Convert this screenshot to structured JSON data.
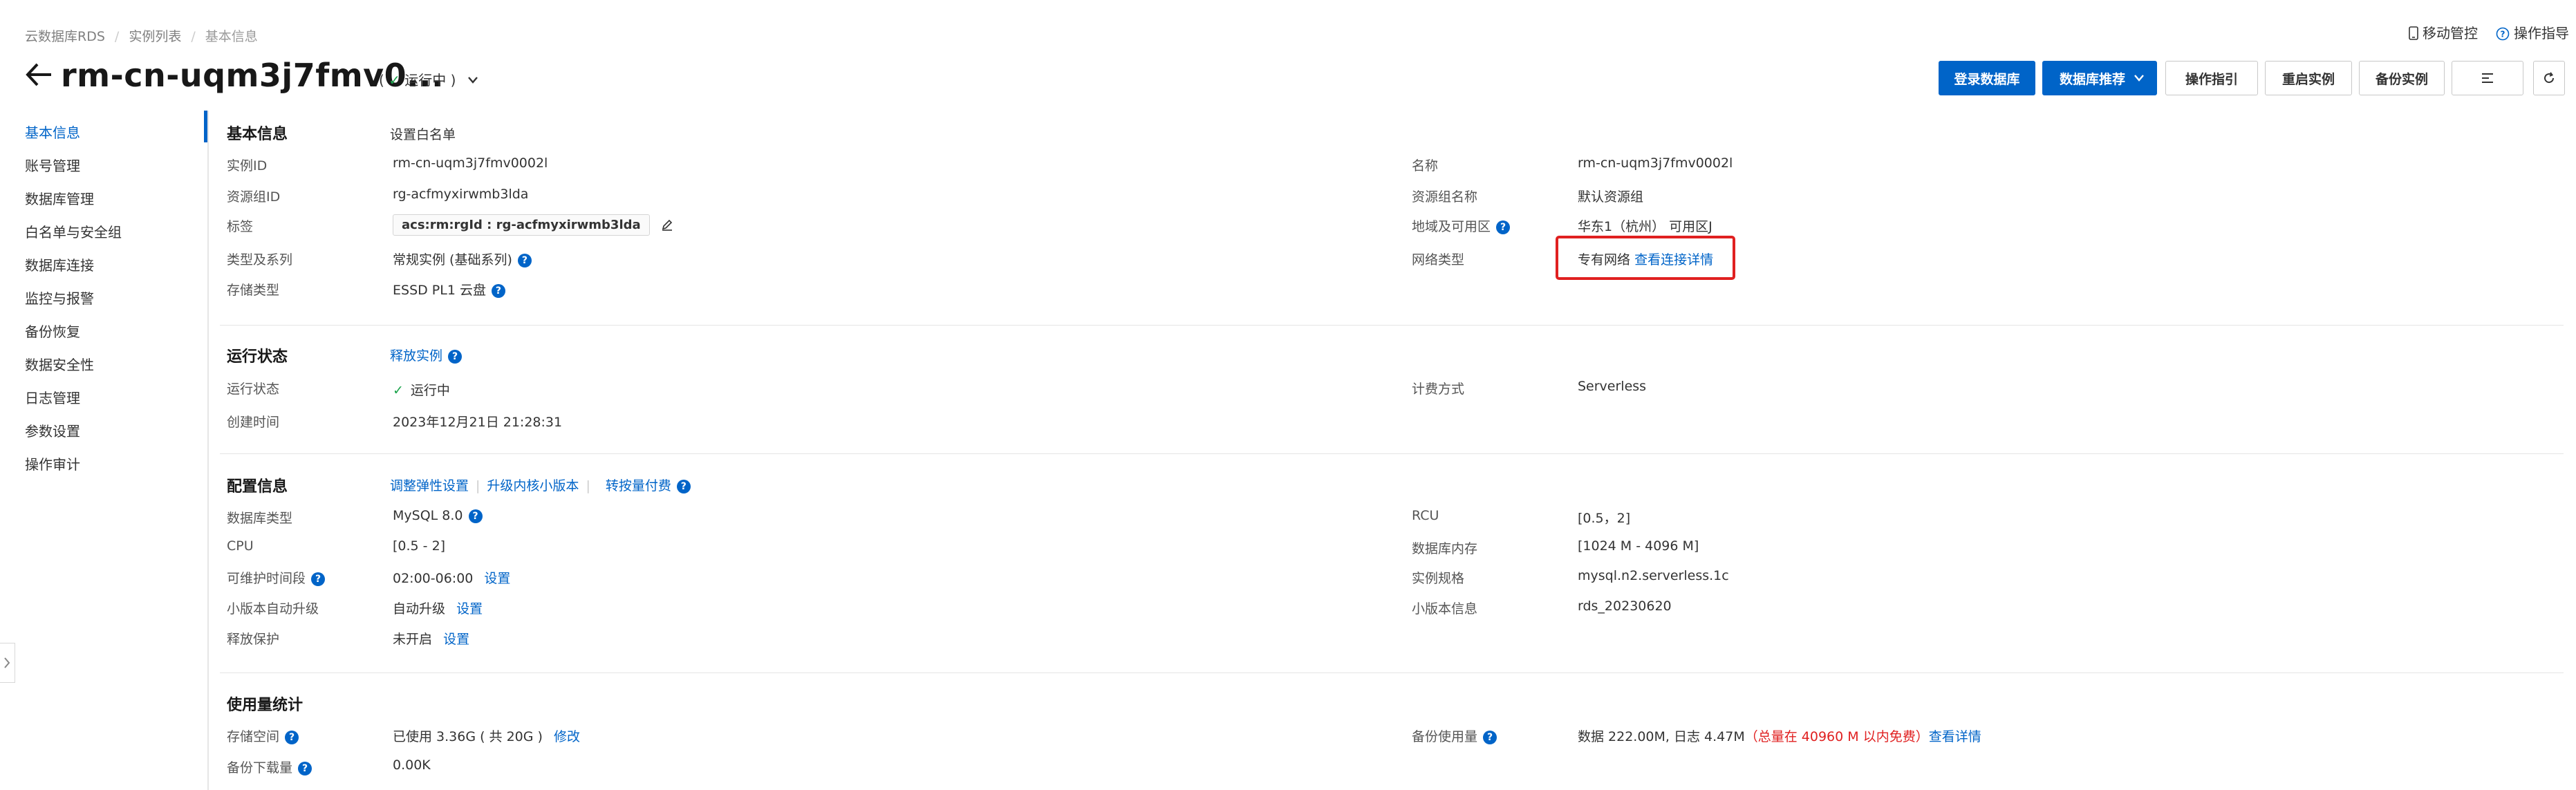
{
  "breadcrumb": [
    "云数据库RDS",
    "实例列表",
    "基本信息"
  ],
  "top_links": {
    "mobile": "移动管控",
    "guide": "操作指导"
  },
  "header": {
    "title": "rm-cn-uqm3j7fmv0...",
    "status": "运行中"
  },
  "buttons": {
    "login": "登录数据库",
    "recommend": "数据库推荐",
    "guide": "操作指引",
    "restart": "重启实例",
    "backup": "备份实例"
  },
  "nav": [
    "基本信息",
    "账号管理",
    "数据库管理",
    "白名单与安全组",
    "数据库连接",
    "监控与报警",
    "备份恢复",
    "数据安全性",
    "日志管理",
    "参数设置",
    "操作审计"
  ],
  "basic": {
    "title": "基本信息",
    "action": "设置白名单",
    "instance_id_label": "实例ID",
    "instance_id": "rm-cn-uqm3j7fmv0002l",
    "rg_id_label": "资源组ID",
    "rg_id": "rg-acfmyxirwmb3lda",
    "tag_label": "标签",
    "tag": "acs:rm:rgId : rg-acfmyxirwmb3lda",
    "type_label": "类型及系列",
    "type": "常规实例 (基础系列)",
    "storage_label": "存储类型",
    "storage": "ESSD PL1 云盘",
    "name_label": "名称",
    "name": "rm-cn-uqm3j7fmv0002l",
    "rg_name_label": "资源组名称",
    "rg_name": "默认资源组",
    "region_label": "地域及可用区",
    "region": "华东1（杭州） 可用区J",
    "network_label": "网络类型",
    "network": "专有网络",
    "network_link": "查看连接详情"
  },
  "running": {
    "title": "运行状态",
    "action": "释放实例",
    "status_label": "运行状态",
    "status": "运行中",
    "created_label": "创建时间",
    "created": "2023年12月21日 21:28:31",
    "billing_label": "计费方式",
    "billing": "Serverless"
  },
  "config": {
    "title": "配置信息",
    "action1": "调整弹性设置",
    "action2": "升级内核小版本",
    "action3": "转按量付费",
    "dbtype_label": "数据库类型",
    "dbtype": "MySQL  8.0",
    "cpu_label": "CPU",
    "cpu": "[0.5 - 2]",
    "maint_label": "可维护时间段",
    "maint": "02:00-06:00",
    "set": "设置",
    "minor_upgrade_label": "小版本自动升级",
    "minor_upgrade": "自动升级",
    "release_label": "释放保护",
    "release": "未开启",
    "rcu_label": "RCU",
    "rcu": "[0.5，2]",
    "mem_label": "数据库内存",
    "mem": "[1024 M - 4096 M]",
    "spec_label": "实例规格",
    "spec": "mysql.n2.serverless.1c",
    "minor_label": "小版本信息",
    "minor": "rds_20230620"
  },
  "usage": {
    "title": "使用量统计",
    "storage_label": "存储空间",
    "storage": "已使用 3.36G ( 共 20G )",
    "modify": "修改",
    "download_label": "备份下载量",
    "download": "0.00K",
    "backup_label": "备份使用量",
    "backup": "数据 222.00M, 日志 4.47M",
    "backup_free": "（总量在 40960 M 以内免费）",
    "backup_link": "查看详情"
  },
  "colors": {
    "accent": "#0064c8",
    "highlight": "#e02020",
    "success": "#1aa34a"
  }
}
